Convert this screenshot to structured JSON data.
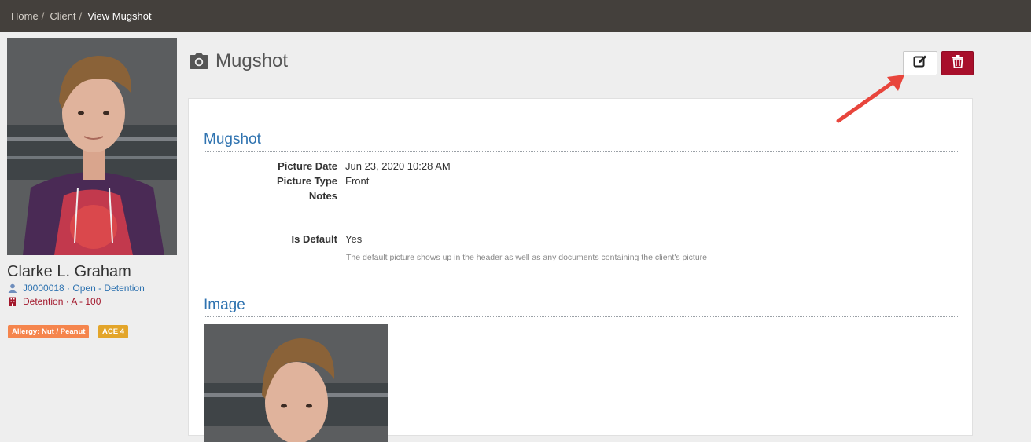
{
  "breadcrumb": {
    "items": [
      "Home",
      "Client"
    ],
    "current": "View Mugshot"
  },
  "client": {
    "name": "Clarke L. Graham",
    "id_status": "J0000018 · Open - Detention",
    "location": "Detention · A - 100",
    "badges": {
      "allergy": "Allergy: Nut / Peanut",
      "ace": "ACE 4"
    }
  },
  "page": {
    "title": "Mugshot",
    "icon": "camera-icon"
  },
  "toolbar": {
    "edit_icon": "edit-icon",
    "delete_icon": "trash-icon"
  },
  "details": {
    "section_title": "Mugshot",
    "fields": {
      "picture_date": {
        "label": "Picture Date",
        "value": "Jun 23, 2020 10:28 AM"
      },
      "picture_type": {
        "label": "Picture Type",
        "value": "Front"
      },
      "notes": {
        "label": "Notes",
        "value": ""
      },
      "is_default": {
        "label": "Is Default",
        "value": "Yes"
      }
    },
    "default_help": "The default picture shows up in the header as well as any documents containing the client's picture"
  },
  "image_section": {
    "title": "Image"
  },
  "colors": {
    "topbar": "#44403c",
    "link": "#2f73b0",
    "delete": "#a80f2b",
    "allergy_badge": "#f5854d",
    "ace_badge": "#e3a52a",
    "annotation_arrow": "#e8453c"
  }
}
